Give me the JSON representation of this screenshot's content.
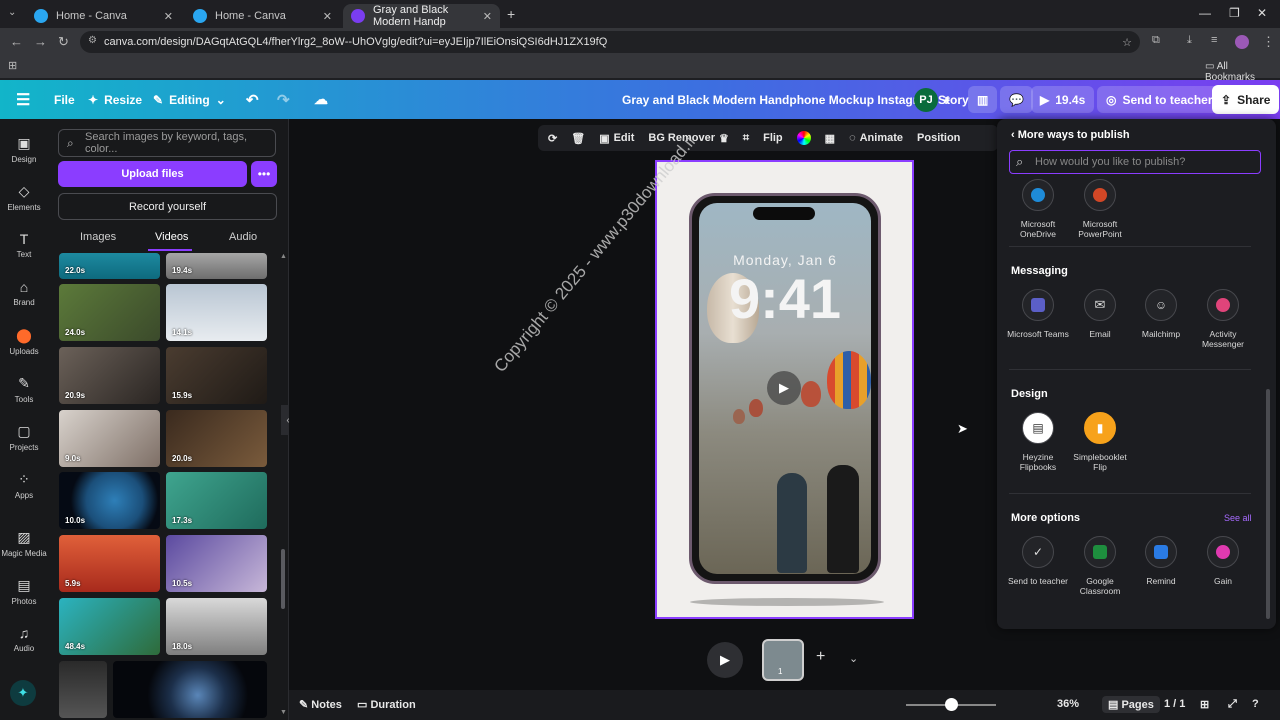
{
  "browser": {
    "tabs": [
      {
        "label": "Home - Canva"
      },
      {
        "label": "Home - Canva"
      },
      {
        "label": "Gray and Black Modern Handp"
      }
    ],
    "url": "canva.com/design/DAGqtAtGQL4/fherYlrg2_8oW--UhOVglg/edit?ui=eyJEIjp7IlEiOnsiQSI6dHJ1ZX19fQ",
    "bookmarks_label": "All Bookmarks"
  },
  "header": {
    "file": "File",
    "resize": "Resize",
    "editing": "Editing",
    "design_title": "Gray and Black Modern Handphone Mockup Instagram Story",
    "avatar": "PJ",
    "timer": "19.4s",
    "send_to_teacher": "Send to teacher",
    "share": "Share"
  },
  "rail": [
    {
      "label": "Design"
    },
    {
      "label": "Elements"
    },
    {
      "label": "Text"
    },
    {
      "label": "Brand"
    },
    {
      "label": "Uploads"
    },
    {
      "label": "Tools"
    },
    {
      "label": "Projects"
    },
    {
      "label": "Apps"
    },
    {
      "label": "Magic Media"
    },
    {
      "label": "Photos"
    },
    {
      "label": "Audio"
    }
  ],
  "panel": {
    "search_placeholder": "Search images by keyword, tags, color...",
    "upload": "Upload files",
    "record": "Record yourself",
    "tabs": [
      "Images",
      "Videos",
      "Audio"
    ],
    "videos": [
      "22.0s",
      "19.4s",
      "24.0s",
      "14.1s",
      "20.9s",
      "15.9s",
      "9.0s",
      "20.0s",
      "10.0s",
      "17.3s",
      "5.9s",
      "10.5s",
      "48.4s",
      "18.0s",
      "",
      ""
    ]
  },
  "toolbar": {
    "edit": "Edit",
    "bg_remover": "BG Remover",
    "flip": "Flip",
    "animate": "Animate",
    "position": "Position"
  },
  "canvas": {
    "date": "Monday, Jan 6",
    "time": "9:41",
    "watermark": "Copyright © 2025 - www.p30download.ir"
  },
  "publish": {
    "title": "More ways to publish",
    "search_placeholder": "How would you like to publish?",
    "top_items": [
      "Microsoft OneDrive",
      "Microsoft PowerPoint"
    ],
    "messaging_title": "Messaging",
    "messaging": [
      "Microsoft Teams",
      "Email",
      "Mailchimp",
      "Activity Messenger"
    ],
    "design_title": "Design",
    "design": [
      "Heyzine Flipbooks",
      "Simplebooklet Flip"
    ],
    "more_title": "More options",
    "see_all": "See all",
    "more": [
      "Send to teacher",
      "Google Classroom",
      "Remind",
      "Gain"
    ]
  },
  "bottom": {
    "notes": "Notes",
    "duration": "Duration",
    "zoom": "36%",
    "pages": "Pages",
    "page_count": "1 / 1",
    "page_thumb_number": "1",
    "zoom_level": 0.36
  },
  "colors": {
    "accent": "#8b3dff",
    "header_start": "#12b5c9",
    "header_end": "#7a3df0"
  }
}
